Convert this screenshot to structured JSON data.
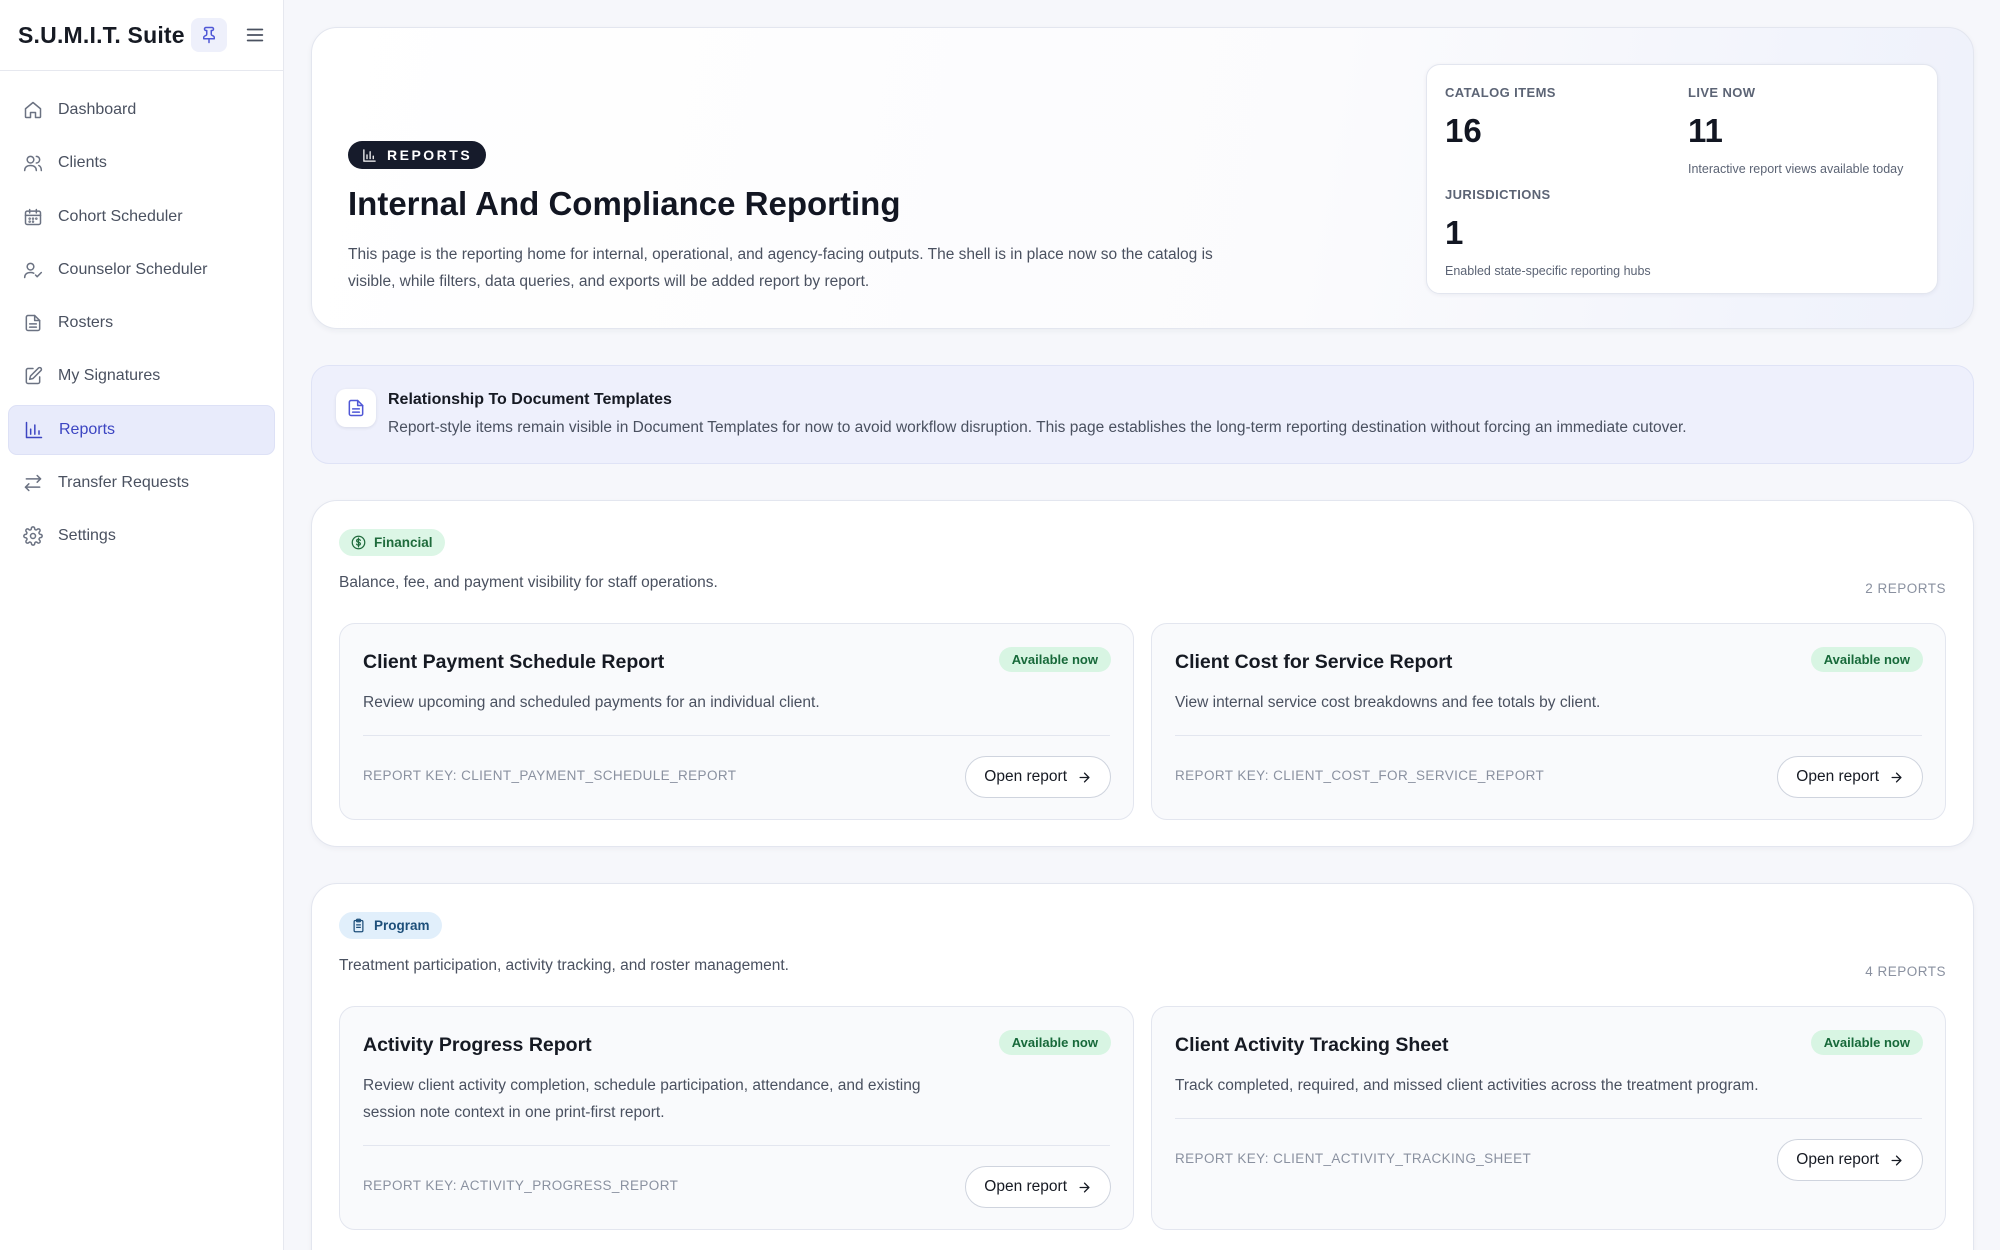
{
  "sidebar": {
    "brand": "S.U.M.I.T. Suite",
    "items": [
      {
        "label": "Dashboard",
        "icon": "home-icon"
      },
      {
        "label": "Clients",
        "icon": "users-icon"
      },
      {
        "label": "Cohort Scheduler",
        "icon": "calendar-icon"
      },
      {
        "label": "Counselor Scheduler",
        "icon": "user-check-icon"
      },
      {
        "label": "Rosters",
        "icon": "file-text-icon"
      },
      {
        "label": "My Signatures",
        "icon": "pen-square-icon"
      },
      {
        "label": "Reports",
        "icon": "bar-chart-icon",
        "active": true
      },
      {
        "label": "Transfer Requests",
        "icon": "arrows-swap-icon"
      },
      {
        "label": "Settings",
        "icon": "gear-icon"
      }
    ]
  },
  "hero": {
    "badge": "REPORTS",
    "title": "Internal And Compliance Reporting",
    "description": "This page is the reporting home for internal, operational, and agency-facing outputs. The shell is in place now so the catalog is visible, while filters, data queries, and exports will be added report by report."
  },
  "stats": {
    "catalog": {
      "label": "CATALOG ITEMS",
      "value": "16"
    },
    "live": {
      "label": "LIVE NOW",
      "value": "11",
      "sub": "Interactive report views available today"
    },
    "jurisdictions": {
      "label": "JURISDICTIONS",
      "value": "1",
      "sub": "Enabled state-specific reporting hubs"
    }
  },
  "notice": {
    "title": "Relationship To Document Templates",
    "text": "Report-style items remain visible in Document Templates for now to avoid workflow disruption. This page establishes the long-term reporting destination without forcing an immediate cutover."
  },
  "financial": {
    "badge": "Financial",
    "description": "Balance, fee, and payment visibility for staff operations.",
    "count": "2 REPORTS",
    "cards": [
      {
        "title": "Client Payment Schedule Report",
        "status": "Available now",
        "description": "Review upcoming and scheduled payments for an individual client.",
        "key": "REPORT KEY: CLIENT_PAYMENT_SCHEDULE_REPORT",
        "button": "Open report"
      },
      {
        "title": "Client Cost for Service Report",
        "status": "Available now",
        "description": "View internal service cost breakdowns and fee totals by client.",
        "key": "REPORT KEY: CLIENT_COST_FOR_SERVICE_REPORT",
        "button": "Open report"
      }
    ]
  },
  "program": {
    "badge": "Program",
    "description": "Treatment participation, activity tracking, and roster management.",
    "count": "4 REPORTS",
    "cards": [
      {
        "title": "Activity Progress Report",
        "status": "Available now",
        "description": "Review client activity completion, schedule participation, attendance, and existing session note context in one print-first report.",
        "key": "REPORT KEY: ACTIVITY_PROGRESS_REPORT",
        "button": "Open report"
      },
      {
        "title": "Client Activity Tracking Sheet",
        "status": "Available now",
        "description": "Track completed, required, and missed client activities across the treatment program.",
        "key": "REPORT KEY: CLIENT_ACTIVITY_TRACKING_SHEET",
        "button": "Open report"
      }
    ]
  },
  "colors": {
    "accent": "#3c45c2",
    "brand_dark": "#161b2b",
    "success": "#17693a"
  }
}
